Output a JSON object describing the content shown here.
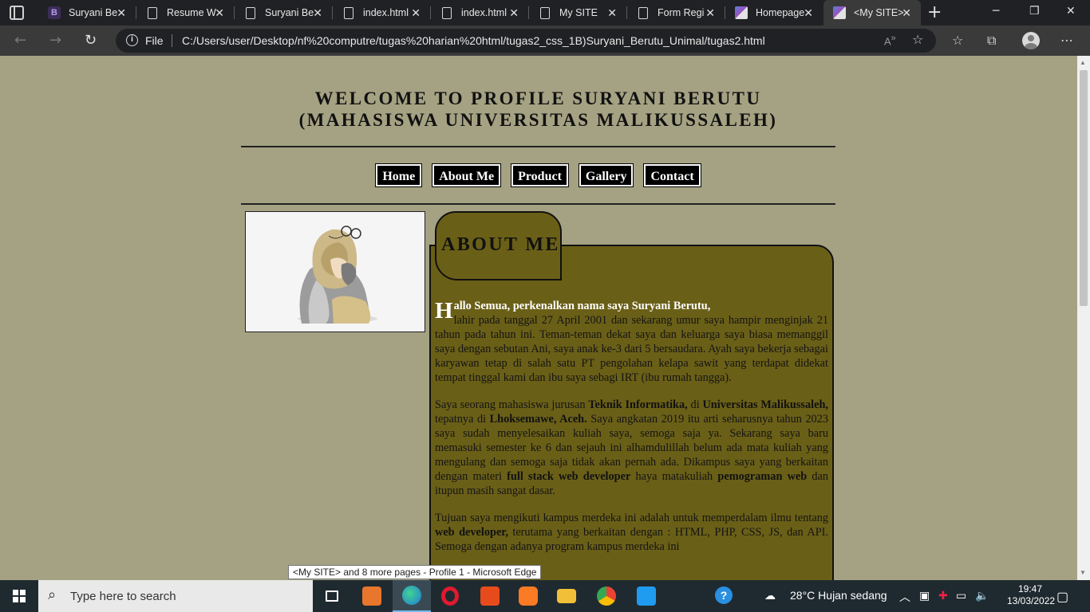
{
  "browser": {
    "tabs": [
      {
        "title": "Suryani Be",
        "icon": "b-icon"
      },
      {
        "title": "Resume W",
        "icon": "document-icon"
      },
      {
        "title": "Suryani Be",
        "icon": "document-icon"
      },
      {
        "title": "index.html",
        "icon": "document-icon"
      },
      {
        "title": "index.html",
        "icon": "document-icon"
      },
      {
        "title": "My SITE",
        "icon": "document-icon"
      },
      {
        "title": "Form Regi",
        "icon": "document-icon"
      },
      {
        "title": "Homepage",
        "icon": "image-icon"
      },
      {
        "title": "<My SITE>",
        "icon": "image-icon"
      }
    ],
    "active_tab": 8,
    "close_glyph": "✕",
    "new_tab_glyph": "+",
    "address": {
      "scheme_label": "File",
      "url": "C:/Users/user/Desktop/nf%20computre/tugas%20harian%20html/tugas2_css_1B)Suryani_Berutu_Unimal/tugas2.html"
    }
  },
  "page": {
    "title_line1": "WELCOME TO PROFILE SURYANI BERUTU",
    "title_line2": "(MAHASISWA UNIVERSITAS MALIKUSSALEH)",
    "menu": [
      "Home",
      "About Me",
      "Product",
      "Gallery",
      "Contact"
    ],
    "about": {
      "heading": "ABOUT ME",
      "dropcap": "H",
      "lead": "allo Semua, perkenalkan nama saya Suryani Berutu,",
      "p1_rest": "lahir pada tanggal 27 April 2001 dan sekarang umur saya hampir menginjak 21 tahun pada tahun ini. Teman-teman dekat saya dan keluarga saya biasa memanggil saya dengan sebutan Ani, saya anak ke-3 dari 5 bersaudara. Ayah saya bekerja sebagai karyawan tetap di salah satu PT pengolahan kelapa sawit yang terdapat didekat tempat tinggal kami dan ibu saya sebagi IRT (ibu rumah tangga).",
      "p2_a": "Saya seorang mahasiswa jurusan ",
      "p2_b": "Teknik Informatika,",
      "p2_c": " di ",
      "p2_d": "Universitas Malikussaleh,",
      "p2_e": " tepatnya di ",
      "p2_f": "Lhoksemawe, Aceh.",
      "p2_g": " Saya angkatan 2019 itu arti seharusnya tahun 2023 saya sudah menyelesaikan kuliah saya, semoga saja ya. Sekarang saya baru memasuki semester ke 6 dan sejauh ini alhamdulillah belum ada mata kuliah yang mengulang dan semoga saja tidak akan pernah ada. Dikampus saya yang berkaitan dengan materi ",
      "p2_h": "full stack web developer",
      "p2_i": " haya matakuliah ",
      "p2_j": "pemograman web",
      "p2_k": " dan itupun masih sangat dasar.",
      "p3_a": "Tujuan saya mengikuti kampus merdeka ini adalah untuk memperdalam ilmu tentang ",
      "p3_b": "web developer,",
      "p3_c": " terutama yang berkaitan dengan : HTML, PHP, CSS, JS, dan API. Semoga dengan adanya program kampus merdeka ini"
    }
  },
  "tooltip": "<My SITE> and 8 more pages - Profile 1 - Microsoft Edge",
  "taskbar": {
    "search_placeholder": "Type here to search",
    "weather": "28°C  Hujan sedang",
    "time": "19:47",
    "date": "13/03/2022"
  },
  "colors": {
    "page_bg": "#a5a283",
    "about_bg": "#6a5f17",
    "menu_bg": "#000000"
  }
}
